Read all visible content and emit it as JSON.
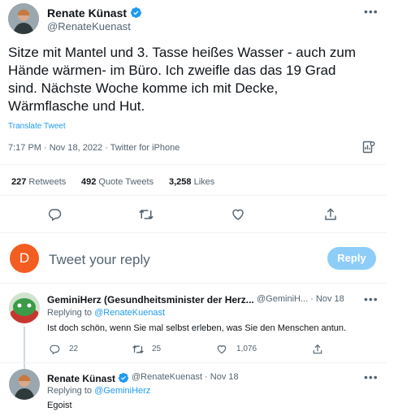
{
  "main_tweet": {
    "author_name": "Renate Künast",
    "handle": "@RenateKuenast",
    "text": "Sitze mit Mantel und 3. Tasse heißes Wasser - auch zum Hände wärmen- im Büro. Ich zweifle das das 19 Grad sind. Nächste Woche komme ich mit Decke, Wärmflasche und Hut.",
    "translate_label": "Translate Tweet",
    "timestamp": "7:17 PM · Nov 18, 2022 · Twitter for iPhone",
    "retweets_count": "227",
    "retweets_label": "Retweets",
    "quotes_count": "492",
    "quotes_label": "Quote Tweets",
    "likes_count": "3,258",
    "likes_label": "Likes"
  },
  "compose": {
    "avatar_letter": "D",
    "placeholder": "Tweet your reply",
    "reply_button": "Reply"
  },
  "replies": [
    {
      "author_name": "GeminiHerz (Gesundheitsminister der Herz...",
      "handle_time": "@GeminiH...  · Nov 18",
      "replying_label": "Replying to",
      "replying_to": "@RenateKuenast",
      "text": "Ist doch schön, wenn Sie mal selbst erleben, was Sie den Menschen antun.",
      "reply_count": "22",
      "retweet_count": "25",
      "like_count": "1,076"
    },
    {
      "author_name": "Renate Künast",
      "handle_time": "@RenateKuenast · Nov 18",
      "replying_label": "Replying to",
      "replying_to": "@GeminiHerz",
      "text": "Egoist"
    }
  ],
  "colors": {
    "accent": "#1d9bf0",
    "compose_avatar": "#f45d22",
    "muted_text": "#536471"
  }
}
